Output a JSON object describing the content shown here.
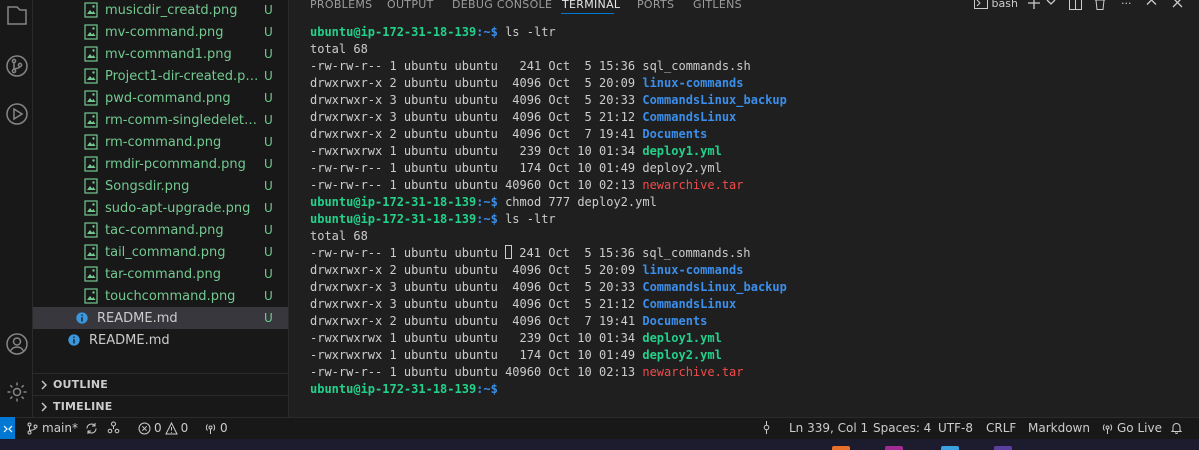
{
  "explorer": {
    "files": [
      {
        "name": "musicdir_creatd.png",
        "status": "U"
      },
      {
        "name": "mv-command.png",
        "status": "U"
      },
      {
        "name": "mv-command1.png",
        "status": "U"
      },
      {
        "name": "Project1-dir-created.png",
        "status": "U"
      },
      {
        "name": "pwd-command.png",
        "status": "U"
      },
      {
        "name": "rm-comm-singledeletion...",
        "status": "U"
      },
      {
        "name": "rm-command.png",
        "status": "U"
      },
      {
        "name": "rmdir-pcommand.png",
        "status": "U"
      },
      {
        "name": "Songsdir.png",
        "status": "U"
      },
      {
        "name": "sudo-apt-upgrade.png",
        "status": "U"
      },
      {
        "name": "tac-command.png",
        "status": "U"
      },
      {
        "name": "tail_command.png",
        "status": "U"
      },
      {
        "name": "tar-command.png",
        "status": "U"
      },
      {
        "name": "touchcommand.png",
        "status": "U"
      }
    ],
    "readme_nested": {
      "name": "README.md",
      "status": "U"
    },
    "readme_root": {
      "name": "README.md"
    },
    "sections": {
      "outline": "OUTLINE",
      "timeline": "TIMELINE"
    }
  },
  "panel": {
    "tabs": [
      "PROBLEMS",
      "OUTPUT",
      "DEBUG CONSOLE",
      "TERMINAL",
      "PORTS",
      "GITLENS"
    ],
    "active_tab": "TERMINAL",
    "shell_label": "bash"
  },
  "terminal": {
    "prompt_user": "ubuntu@ip-172-31-18-139",
    "prompt_path": ":~$",
    "cmd1": " ls -ltr",
    "total1": "total 68",
    "listing1": [
      {
        "meta": "-rw-rw-r-- 1 ubuntu ubuntu   241 Oct  5 15:36 ",
        "name": "sql_commands.sh",
        "kind": "plain"
      },
      {
        "meta": "drwxrwxr-x 2 ubuntu ubuntu  4096 Oct  5 20:09 ",
        "name": "linux-commands",
        "kind": "dir"
      },
      {
        "meta": "drwxrwxr-x 3 ubuntu ubuntu  4096 Oct  5 20:33 ",
        "name": "CommandsLinux_backup",
        "kind": "dir"
      },
      {
        "meta": "drwxrwxr-x 3 ubuntu ubuntu  4096 Oct  5 21:12 ",
        "name": "CommandsLinux",
        "kind": "dir"
      },
      {
        "meta": "drwxrwxr-x 2 ubuntu ubuntu  4096 Oct  7 19:41 ",
        "name": "Documents",
        "kind": "dir"
      },
      {
        "meta": "-rwxrwxrwx 1 ubuntu ubuntu   239 Oct 10 01:34 ",
        "name": "deploy1.yml",
        "kind": "exec"
      },
      {
        "meta": "-rw-rw-r-- 1 ubuntu ubuntu   174 Oct 10 01:49 ",
        "name": "deploy2.yml",
        "kind": "plain"
      },
      {
        "meta": "-rw-rw-r-- 1 ubuntu ubuntu 40960 Oct 10 02:13 ",
        "name": "newarchive.tar",
        "kind": "archive"
      }
    ],
    "cmd2": " chmod 777 deploy2.yml",
    "cmd3": " ls -ltr",
    "total2": "total 68",
    "listing2": [
      {
        "meta_a": "-rw-rw-r-- 1 ubuntu ubuntu ",
        "meta_b": " 241 Oct  5 15:36 ",
        "name": "sql_commands.sh",
        "kind": "plain"
      },
      {
        "meta": "drwxrwxr-x 2 ubuntu ubuntu  4096 Oct  5 20:09 ",
        "name": "linux-commands",
        "kind": "dir"
      },
      {
        "meta": "drwxrwxr-x 3 ubuntu ubuntu  4096 Oct  5 20:33 ",
        "name": "CommandsLinux_backup",
        "kind": "dir"
      },
      {
        "meta": "drwxrwxr-x 3 ubuntu ubuntu  4096 Oct  5 21:12 ",
        "name": "CommandsLinux",
        "kind": "dir"
      },
      {
        "meta": "drwxrwxr-x 2 ubuntu ubuntu  4096 Oct  7 19:41 ",
        "name": "Documents",
        "kind": "dir"
      },
      {
        "meta": "-rwxrwxrwx 1 ubuntu ubuntu   239 Oct 10 01:34 ",
        "name": "deploy1.yml",
        "kind": "exec"
      },
      {
        "meta": "-rwxrwxrwx 1 ubuntu ubuntu   174 Oct 10 01:49 ",
        "name": "deploy2.yml",
        "kind": "exec"
      },
      {
        "meta": "-rw-rw-r-- 1 ubuntu ubuntu 40960 Oct 10 02:13 ",
        "name": "newarchive.tar",
        "kind": "archive"
      }
    ]
  },
  "statusbar": {
    "branch": "main*",
    "errors": "0",
    "warnings": "0",
    "ports": "0",
    "cursor_position": "Ln 339, Col 1",
    "spaces": "Spaces: 4",
    "encoding": "UTF-8",
    "eol": "CRLF",
    "language": "Markdown",
    "go_live": "Go Live"
  },
  "colors": {
    "accent": "#0078d4",
    "git_untracked": "#73c991",
    "term_green": "#23d18b",
    "term_blue": "#3b8eea",
    "term_red": "#f14c4c"
  }
}
